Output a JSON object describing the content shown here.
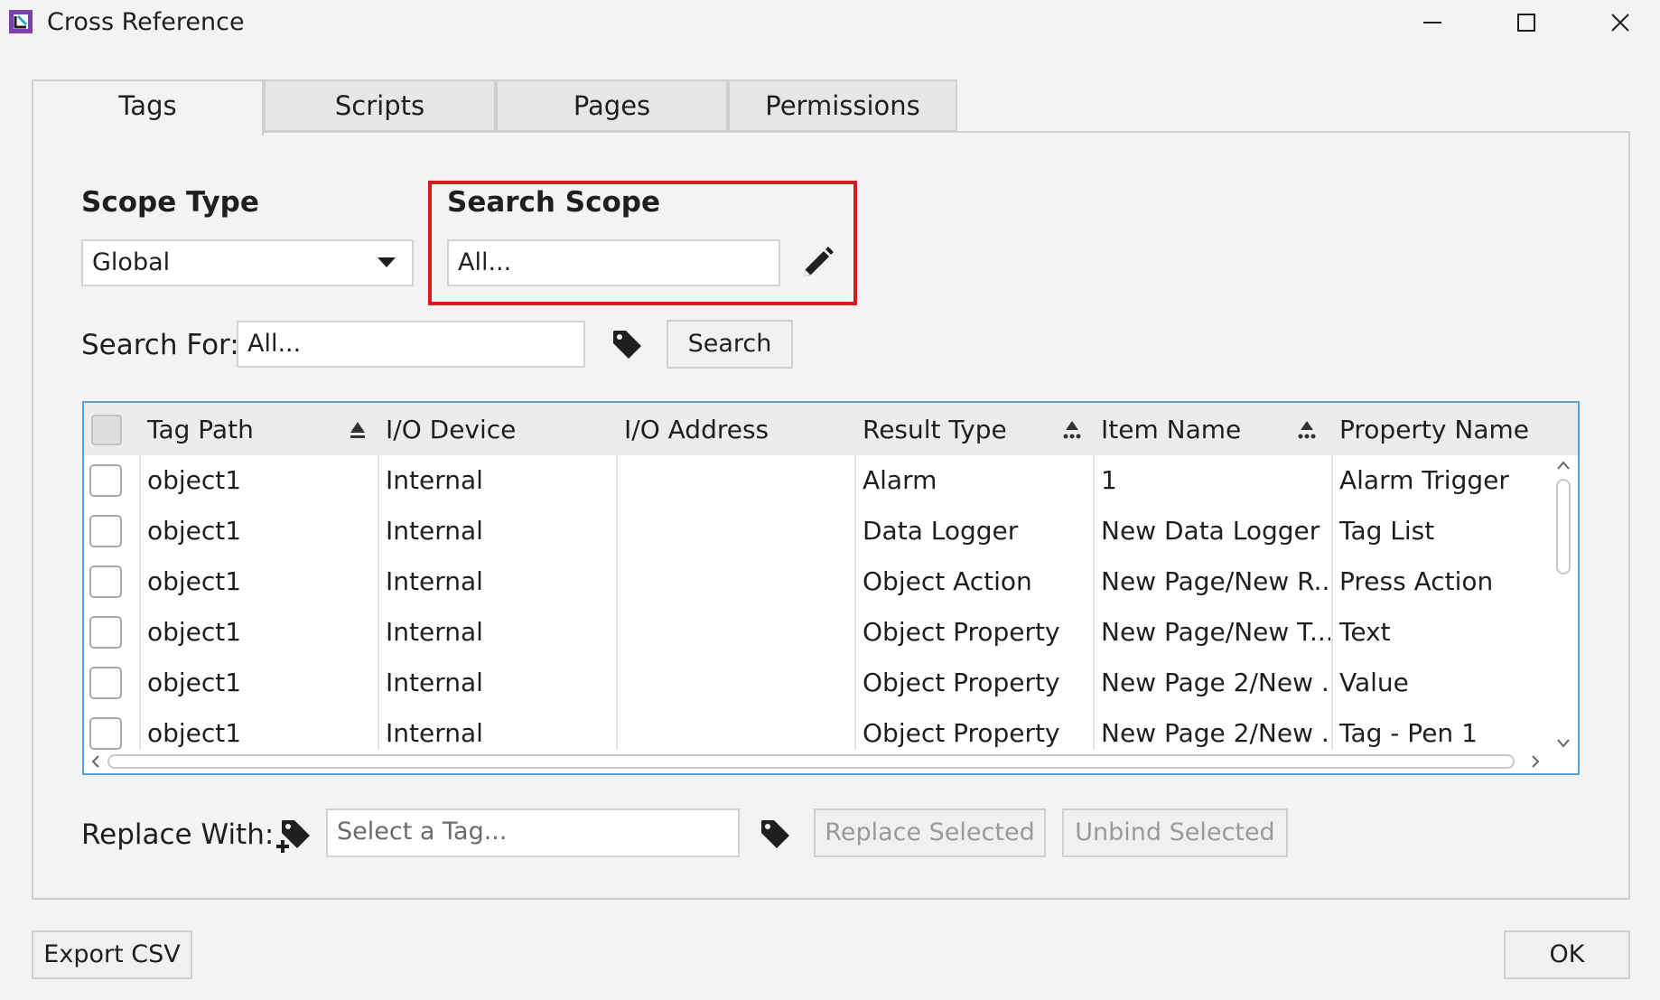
{
  "window": {
    "title": "Cross Reference"
  },
  "tabs": [
    {
      "label": "Tags"
    },
    {
      "label": "Scripts"
    },
    {
      "label": "Pages"
    },
    {
      "label": "Permissions"
    }
  ],
  "scope_type": {
    "label": "Scope Type",
    "value": "Global"
  },
  "search_scope": {
    "label": "Search Scope",
    "value": "All..."
  },
  "search_for": {
    "label": "Search For:",
    "value": "All...",
    "button": "Search"
  },
  "table": {
    "columns": [
      "Tag Path",
      "I/O Device",
      "I/O Address",
      "Result Type",
      "Item Name",
      "Property Name"
    ],
    "rows": [
      [
        "object1",
        "Internal",
        "",
        "Alarm",
        "1",
        "Alarm Trigger"
      ],
      [
        "object1",
        "Internal",
        "",
        "Data Logger",
        "New Data Logger",
        "Tag List"
      ],
      [
        "object1",
        "Internal",
        "",
        "Object Action",
        "New Page/New R...",
        "Press Action"
      ],
      [
        "object1",
        "Internal",
        "",
        "Object Property",
        "New Page/New T...",
        "Text"
      ],
      [
        "object1",
        "Internal",
        "",
        "Object Property",
        "New Page 2/New ...",
        "Value"
      ],
      [
        "object1",
        "Internal",
        "",
        "Object Property",
        "New Page 2/New ...",
        "Tag - Pen 1"
      ]
    ]
  },
  "replace": {
    "label": "Replace With:",
    "placeholder": "Select a Tag...",
    "replace_button": "Replace Selected",
    "unbind_button": "Unbind Selected"
  },
  "footer": {
    "export_button": "Export CSV",
    "ok_button": "OK"
  },
  "colors": {
    "highlight": "#e2161f",
    "grid_border": "#5aa0d8"
  }
}
